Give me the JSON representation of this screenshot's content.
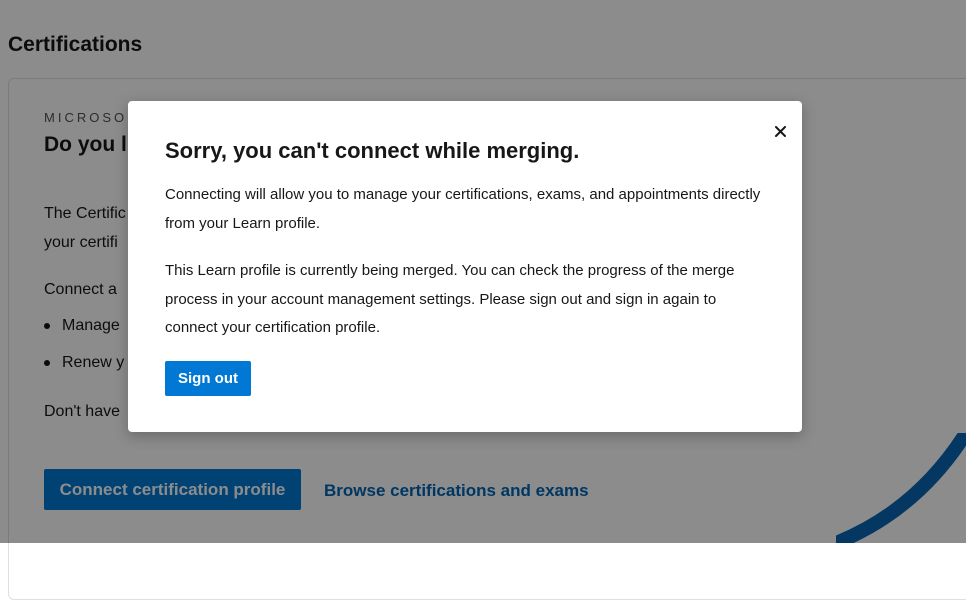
{
  "page": {
    "title": "Certifications"
  },
  "card": {
    "eyebrow": "MICROSO",
    "heading": "Do you l",
    "text1_line1": "The Certific",
    "text1_line2": "your certifi",
    "text2": "Connect a",
    "bullets": [
      "Manage",
      "Renew y"
    ],
    "text3": "Don't have",
    "connect_button": "Connect certification profile",
    "browse_link": "Browse certifications and exams"
  },
  "dialog": {
    "title": "Sorry, you can't connect while merging.",
    "paragraph1": "Connecting will allow you to manage your certifications, exams, and appointments directly from your Learn profile.",
    "paragraph2": "This Learn profile is currently being merged. You can check the progress of the merge process in your account management settings. Please sign out and sign in again to connect your certification profile.",
    "signout_button": "Sign out",
    "close_icon": "close-icon"
  },
  "colors": {
    "accent": "#0078d4",
    "link": "#0065b3",
    "overlay": "rgba(0,0,0,0.45)",
    "decor_stripe": "#0a64b4"
  }
}
